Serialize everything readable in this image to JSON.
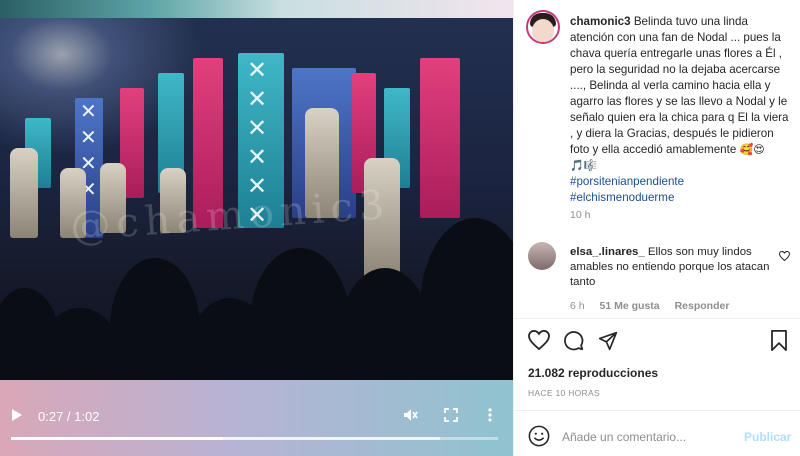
{
  "post": {
    "username": "chamonic3",
    "caption": "Belinda tuvo una linda atención con una fan de Nodal ... pues la chava quería entregarle unas flores a Él , pero la seguridad no la dejaba acercarse ...., Belinda al verla camino hacia ella y agarro las flores y se las llevo a Nodal y le señalo quien era la chica para q El la viera , y diera la Gracias, después le pidieron foto y ella accedió amablemente",
    "caption_emojis": "🥰😍🎵🎼",
    "hashtags": [
      "#porsitenianpendiente",
      "#elchismenoduerme"
    ],
    "time": "10 h",
    "views": "21.082 reproducciones",
    "posted_ago": "HACE 10 HORAS"
  },
  "video": {
    "current_time": "0:27",
    "duration": "1:02",
    "time_display": "0:27 / 1:02",
    "progress_fraction": 0.435,
    "buffered_fraction": 0.88,
    "watermark": "@chamonic3"
  },
  "comments": [
    {
      "username": "elsa_.linares_",
      "text": "Ellos son muy lindos amables no entiendo porque los atacan tanto",
      "time": "6 h",
      "likes": "51 Me gusta",
      "reply_label": "Responder"
    }
  ],
  "composer": {
    "placeholder": "Añade un comentario...",
    "publish_label": "Publicar"
  },
  "colors": {
    "link": "#1e4e8c",
    "publish_disabled": "#b2dffc",
    "muted": "#8e8e8e"
  },
  "icons": [
    "play-icon",
    "mute-icon",
    "fullscreen-icon",
    "more-icon",
    "heart-icon",
    "comment-icon",
    "share-icon",
    "bookmark-icon",
    "emoji-icon"
  ]
}
